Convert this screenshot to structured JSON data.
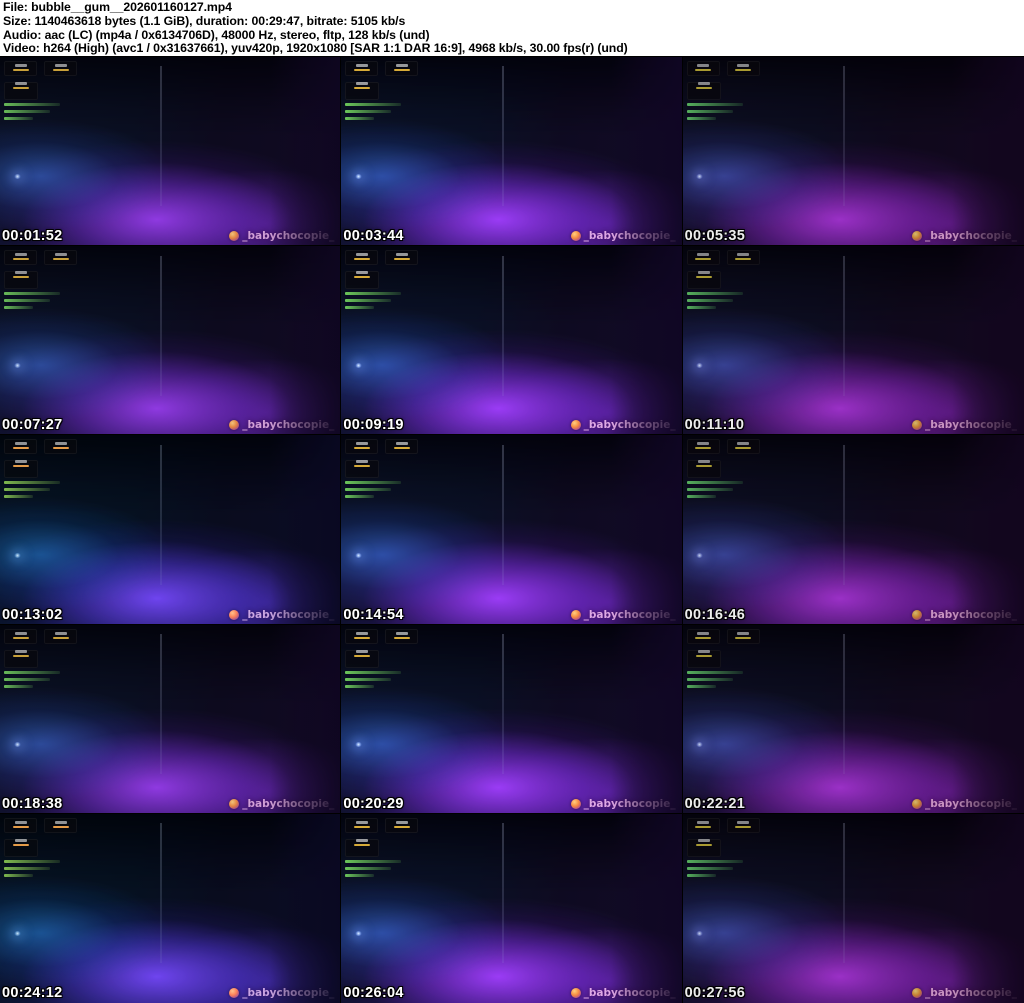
{
  "header": {
    "lines": [
      "File: bubble__gum__202601160127.mp4",
      "Size: 1140463618 bytes (1.1 GiB), duration: 00:29:47, bitrate: 5105 kb/s",
      "Audio: aac (LC) (mp4a / 0x6134706D), 48000 Hz, stereo, fltp, 128 kb/s (und)",
      "Video: h264 (High) (avc1 / 0x31637661), yuv420p, 1920x1080 [SAR 1:1 DAR 16:9], 4968 kb/s, 30.00 fps(r) (und)"
    ],
    "text_color": "#000000",
    "background": "#ffffff"
  },
  "watermark": {
    "text": "_babychocopie_",
    "color": "#dcaade"
  },
  "scene_colors": {
    "glow_violet": "#8a3be0",
    "glow_blue": "#3f6fe0",
    "background_dark": "#070711"
  },
  "thumbnails": [
    {
      "timestamp": "00:01:52"
    },
    {
      "timestamp": "00:03:44"
    },
    {
      "timestamp": "00:05:35"
    },
    {
      "timestamp": "00:07:27"
    },
    {
      "timestamp": "00:09:19"
    },
    {
      "timestamp": "00:11:10"
    },
    {
      "timestamp": "00:13:02"
    },
    {
      "timestamp": "00:14:54"
    },
    {
      "timestamp": "00:16:46"
    },
    {
      "timestamp": "00:18:38"
    },
    {
      "timestamp": "00:20:29"
    },
    {
      "timestamp": "00:22:21"
    },
    {
      "timestamp": "00:24:12"
    },
    {
      "timestamp": "00:26:04"
    },
    {
      "timestamp": "00:27:56"
    }
  ]
}
